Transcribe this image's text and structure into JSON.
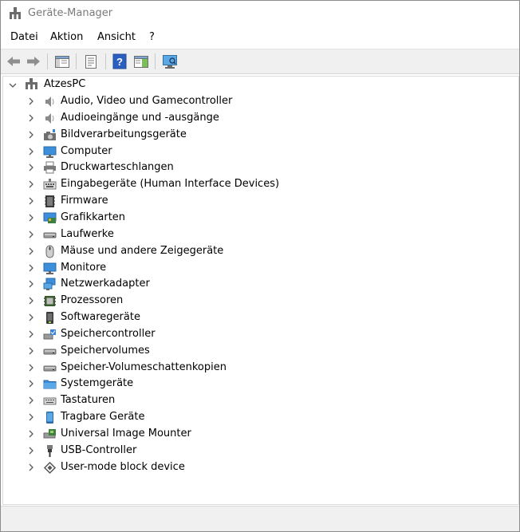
{
  "window": {
    "title": "Geräte-Manager"
  },
  "menu": [
    "Datei",
    "Aktion",
    "Ansicht",
    "?"
  ],
  "toolbar": [
    "back-icon",
    "forward-icon",
    "show-hide-console-tree-icon",
    "properties-icon",
    "help-icon",
    "action-pane-icon",
    "scan-hardware-icon"
  ],
  "tree": {
    "root": {
      "label": "AtzesPC",
      "icon": "computer-icon"
    },
    "items": [
      {
        "label": "Audio, Video und Gamecontroller",
        "icon": "speaker-icon"
      },
      {
        "label": "Audioeingänge und -ausgänge",
        "icon": "speaker-icon"
      },
      {
        "label": "Bildverarbeitungsgeräte",
        "icon": "camera-icon"
      },
      {
        "label": "Computer",
        "icon": "monitor-icon"
      },
      {
        "label": "Druckwarteschlangen",
        "icon": "printer-icon"
      },
      {
        "label": "Eingabegeräte (Human Interface Devices)",
        "icon": "hid-icon"
      },
      {
        "label": "Firmware",
        "icon": "firmware-icon"
      },
      {
        "label": "Grafikkarten",
        "icon": "display-adapter-icon"
      },
      {
        "label": "Laufwerke",
        "icon": "drive-icon"
      },
      {
        "label": "Mäuse und andere Zeigegeräte",
        "icon": "mouse-icon"
      },
      {
        "label": "Monitore",
        "icon": "monitor-icon"
      },
      {
        "label": "Netzwerkadapter",
        "icon": "network-icon"
      },
      {
        "label": "Prozessoren",
        "icon": "processor-icon"
      },
      {
        "label": "Softwaregeräte",
        "icon": "software-device-icon"
      },
      {
        "label": "Speichercontroller",
        "icon": "storage-controller-icon"
      },
      {
        "label": "Speichervolumes",
        "icon": "drive-icon"
      },
      {
        "label": "Speicher-Volumeschattenkopien",
        "icon": "drive-icon"
      },
      {
        "label": "Systemgeräte",
        "icon": "folder-icon"
      },
      {
        "label": "Tastaturen",
        "icon": "keyboard-icon"
      },
      {
        "label": "Tragbare Geräte",
        "icon": "portable-device-icon"
      },
      {
        "label": "Universal Image Mounter",
        "icon": "image-mounter-icon"
      },
      {
        "label": "USB-Controller",
        "icon": "usb-icon"
      },
      {
        "label": "User-mode block device",
        "icon": "block-device-icon"
      }
    ]
  },
  "colors": {
    "title_text": "#7a7a7a",
    "toolbar_bg": "#f0f0f0",
    "accent_blue": "#2f7fd8"
  }
}
